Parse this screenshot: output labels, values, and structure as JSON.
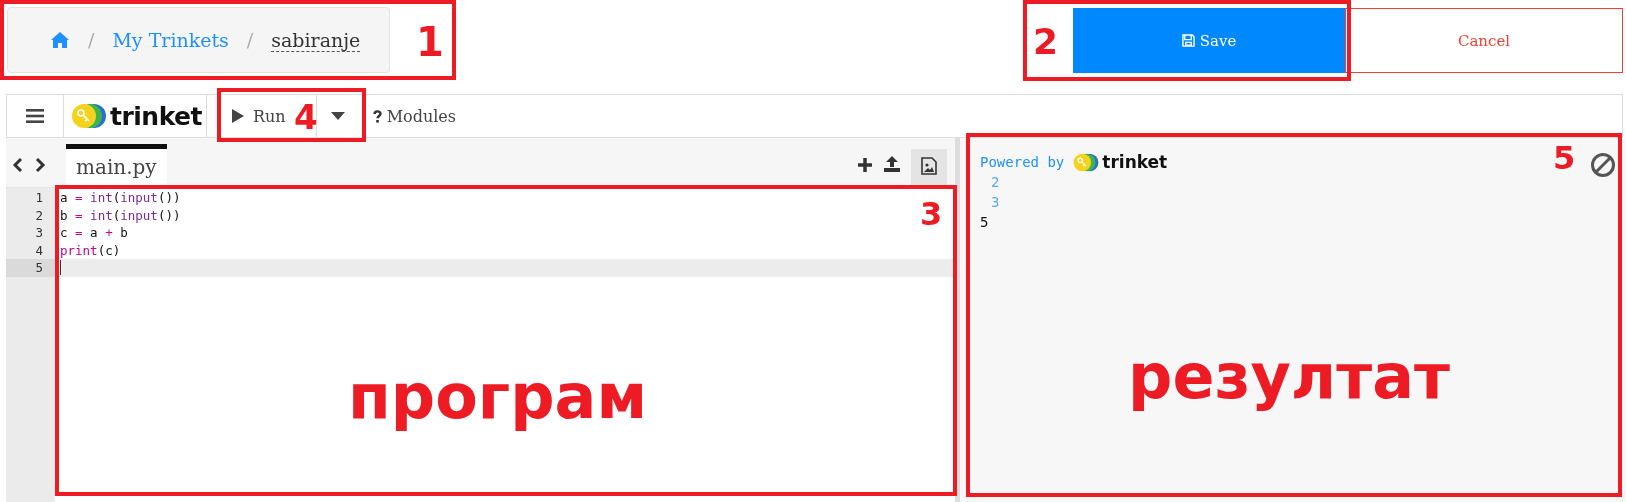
{
  "breadcrumb": {
    "separator": "/",
    "items": [
      {
        "kind": "home"
      },
      {
        "kind": "link",
        "label": "My Trinkets"
      },
      {
        "kind": "current",
        "label": "sabiranje"
      }
    ]
  },
  "actions": [
    {
      "kind": "primary",
      "label": "Save"
    },
    {
      "kind": "outline",
      "label": "Cancel"
    }
  ],
  "toolbar": {
    "logo": "trinket",
    "run": "Run",
    "modules": "Modules"
  },
  "editor": {
    "tab": "main.py",
    "lines": [
      {
        "number": "1",
        "active": false,
        "tokens": [
          {
            "t": "a ",
            "kind": "plain"
          },
          {
            "t": "=",
            "kind": "op"
          },
          {
            "t": " int",
            "kind": "builtin"
          },
          {
            "t": "(",
            "kind": "plain"
          },
          {
            "t": "input",
            "kind": "builtin"
          },
          {
            "t": "())",
            "kind": "plain"
          }
        ]
      },
      {
        "number": "2",
        "active": false,
        "tokens": [
          {
            "t": "b ",
            "kind": "plain"
          },
          {
            "t": "=",
            "kind": "op"
          },
          {
            "t": " int",
            "kind": "builtin"
          },
          {
            "t": "(",
            "kind": "plain"
          },
          {
            "t": "input",
            "kind": "builtin"
          },
          {
            "t": "())",
            "kind": "plain"
          }
        ]
      },
      {
        "number": "3",
        "active": false,
        "tokens": [
          {
            "t": "c ",
            "kind": "plain"
          },
          {
            "t": "=",
            "kind": "op"
          },
          {
            "t": " a ",
            "kind": "plain"
          },
          {
            "t": "+",
            "kind": "op"
          },
          {
            "t": " b",
            "kind": "plain"
          }
        ]
      },
      {
        "number": "4",
        "active": false,
        "tokens": [
          {
            "t": "print",
            "kind": "keyword"
          },
          {
            "t": "(c)",
            "kind": "plain"
          }
        ]
      },
      {
        "number": "5",
        "active": true
      }
    ]
  },
  "output": {
    "powered_by": "Powered by",
    "logo": "trinket",
    "lines": [
      {
        "kind": "input",
        "text": "2"
      },
      {
        "kind": "input",
        "text": "3"
      },
      {
        "kind": "result",
        "text": "5"
      }
    ]
  },
  "annotations": [
    {
      "label": "1"
    },
    {
      "label": "2"
    },
    {
      "label": "3"
    },
    {
      "label": "4"
    },
    {
      "label": "5"
    }
  ],
  "captions": [
    "програм",
    "резултат"
  ]
}
